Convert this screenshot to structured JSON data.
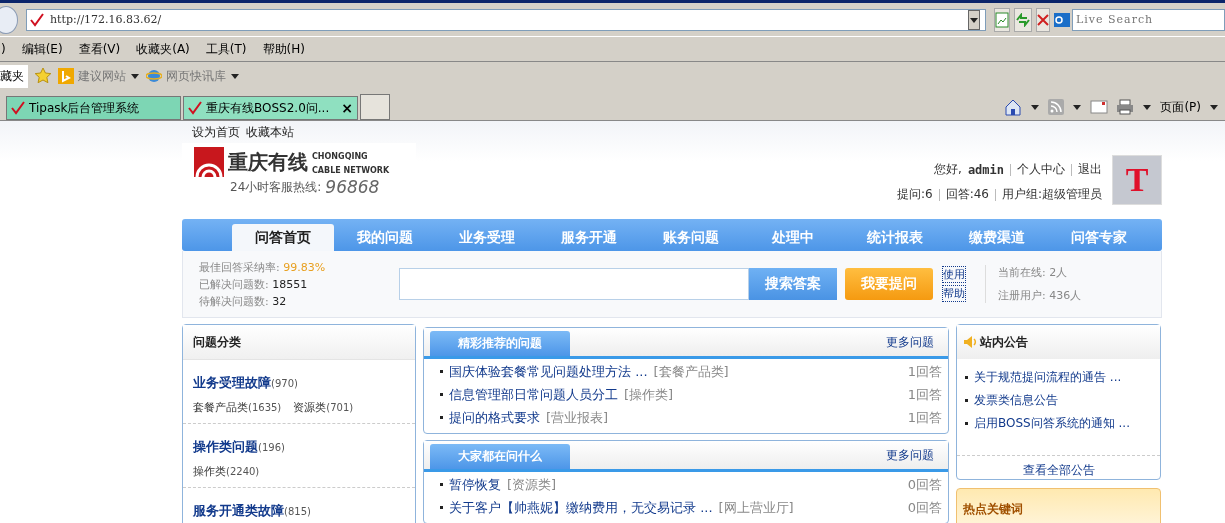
{
  "browser": {
    "address": "http://172.16.83.62/",
    "search_placeholder": "Live Search",
    "menu": [
      ")",
      "编辑(E)",
      "查看(V)",
      "收藏夹(A)",
      "工具(T)",
      "帮助(H)"
    ],
    "favorites_bar": {
      "label": "藏夹",
      "links": [
        "建议网站",
        "网页快讯库"
      ]
    },
    "tabs": [
      {
        "label": "Tipask后台管理系统",
        "selected": false
      },
      {
        "label": "重庆有线BOSS2.0问...",
        "selected": true
      }
    ],
    "tab_close": "×",
    "page_menu": "页面(P)"
  },
  "page": {
    "top_links": [
      "设为首页",
      "收藏本站"
    ],
    "logo": {
      "name": "重庆有线",
      "english": [
        "CHONGQING",
        "CABLE NETWORK"
      ],
      "hotline_label": "24小时客服热线:",
      "hotline": "96868"
    },
    "user": {
      "greeting": "您好,",
      "name": "admin",
      "links": [
        "个人中心",
        "退出"
      ],
      "stats": [
        "提问:6",
        "回答:46",
        "用户组:超级管理员"
      ],
      "avatar_letter": "T"
    },
    "nav": [
      {
        "label": "问答首页",
        "selected": true
      },
      {
        "label": "我的问题",
        "selected": false
      },
      {
        "label": "业务受理",
        "selected": false
      },
      {
        "label": "服务开通",
        "selected": false
      },
      {
        "label": "账务问题",
        "selected": false
      },
      {
        "label": "处理中",
        "selected": false
      },
      {
        "label": "统计报表",
        "selected": false
      },
      {
        "label": "缴费渠道",
        "selected": false
      },
      {
        "label": "问答专家",
        "selected": false
      }
    ],
    "stats": [
      {
        "label": "最佳回答采纳率:",
        "value": "99.83%",
        "highlight": true
      },
      {
        "label": "已解决问题数:",
        "value": "18551",
        "highlight": false
      },
      {
        "label": "待解决问题数:",
        "value": "32",
        "highlight": false
      }
    ],
    "search": {
      "button": "搜索答案",
      "ask_button": "我要提问",
      "help": [
        "使用",
        "帮助"
      ]
    },
    "online": [
      {
        "label": "当前在线:",
        "value": "2人"
      },
      {
        "label": "注册用户:",
        "value": "436人"
      }
    ],
    "categories": {
      "title": "问题分类",
      "groups": [
        {
          "name": "业务受理故障",
          "count": "(970)",
          "children": [
            {
              "name": "套餐产品类",
              "count": "(1635)"
            },
            {
              "name": "资源类",
              "count": "(701)"
            }
          ]
        },
        {
          "name": "操作类问题",
          "count": "(196)",
          "children": [
            {
              "name": "操作类",
              "count": "(2240)"
            }
          ]
        },
        {
          "name": "服务开通类故障",
          "count": "(815)"
        }
      ]
    },
    "question_panels": [
      {
        "title": "精彩推荐的问题",
        "more": "更多问题",
        "items": [
          {
            "title": "国庆体验套餐常见问题处理方法 ...",
            "category": "[套餐产品类]",
            "answers": "1回答"
          },
          {
            "title": "信息管理部日常问题人员分工",
            "category": "[操作类]",
            "answers": "1回答"
          },
          {
            "title": "提问的格式要求",
            "category": "[营业报表]",
            "answers": "1回答"
          }
        ]
      },
      {
        "title": "大家都在问什么",
        "more": "更多问题",
        "items": [
          {
            "title": "暂停恢复",
            "category": "[资源类]",
            "answers": "0回答"
          },
          {
            "title": "关于客户【帅燕妮】缴纳费用，无交易记录 ...",
            "category": "[网上营业厅]",
            "answers": "0回答"
          }
        ]
      }
    ],
    "notices": {
      "title": "站内公告",
      "items": [
        "关于规范提问流程的通告 ...",
        "发票类信息公告",
        "启用BOSS问答系统的通知 ..."
      ],
      "more": "查看全部公告"
    },
    "hot_keywords": {
      "title": "热点关键词"
    }
  }
}
